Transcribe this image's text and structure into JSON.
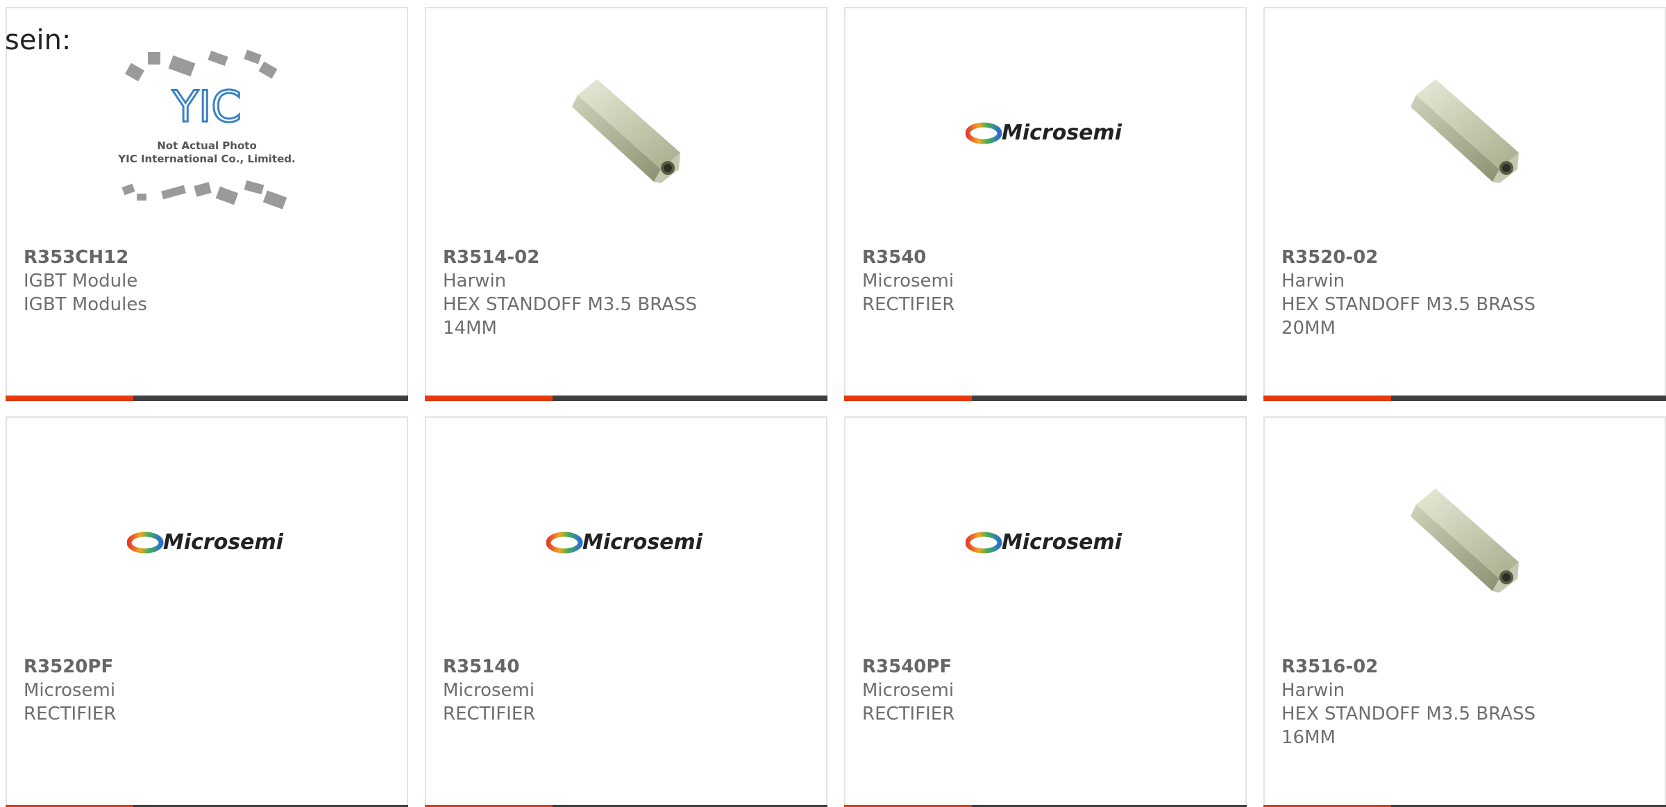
{
  "intro": {
    "text": "sein:"
  },
  "colors": {
    "accent": "#e8390e",
    "bar": "#3f3f3f",
    "text": "#6e6e6e"
  },
  "placeholder": {
    "line1": "Not Actual Photo",
    "line2": "YIC International Co., Limited."
  },
  "cards": [
    {
      "part": "R353CH12",
      "line1": "IGBT Module",
      "line2": "IGBT Modules",
      "line3": "",
      "image": "yic-placeholder-image"
    },
    {
      "part": "R3514-02",
      "line1": "Harwin",
      "line2": "HEX STANDOFF M3.5 BRASS",
      "line3": "14MM",
      "image": "hex-standoff-image"
    },
    {
      "part": "R3540",
      "line1": "Microsemi",
      "line2": "RECTIFIER",
      "line3": "",
      "image": "microsemi-logo"
    },
    {
      "part": "R3520-02",
      "line1": "Harwin",
      "line2": "HEX STANDOFF M3.5 BRASS",
      "line3": "20MM",
      "image": "hex-standoff-image"
    },
    {
      "part": "R3520PF",
      "line1": "Microsemi",
      "line2": "RECTIFIER",
      "line3": "",
      "image": "microsemi-logo"
    },
    {
      "part": "R35140",
      "line1": "Microsemi",
      "line2": "RECTIFIER",
      "line3": "",
      "image": "microsemi-logo"
    },
    {
      "part": "R3540PF",
      "line1": "Microsemi",
      "line2": "RECTIFIER",
      "line3": "",
      "image": "microsemi-logo"
    },
    {
      "part": "R3516-02",
      "line1": "Harwin",
      "line2": "HEX STANDOFF M3.5 BRASS",
      "line3": "16MM",
      "image": "hex-standoff-image"
    }
  ],
  "logos": {
    "microsemi": "Microsemi",
    "yic": "YIC"
  }
}
